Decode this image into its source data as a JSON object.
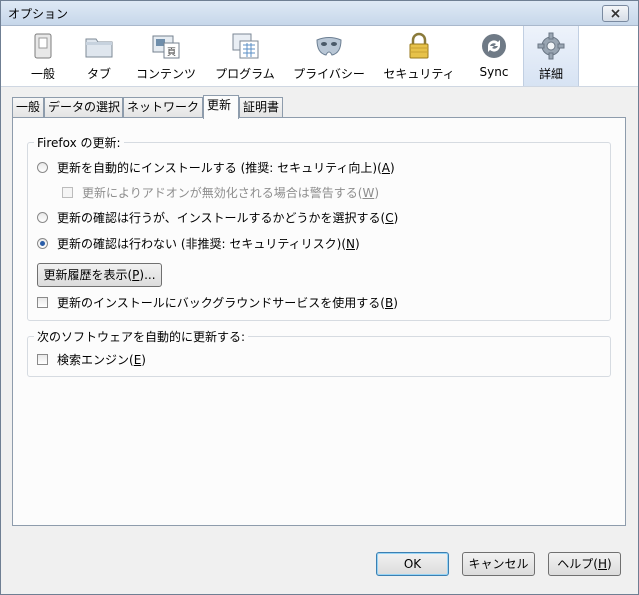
{
  "window": {
    "title": "オプション"
  },
  "toolbar": {
    "items": [
      {
        "label": "一般",
        "icon": "general-switch-icon"
      },
      {
        "label": "タブ",
        "icon": "tabs-folder-icon"
      },
      {
        "label": "コンテンツ",
        "icon": "content-page-icon"
      },
      {
        "label": "プログラム",
        "icon": "applications-calendar-icon"
      },
      {
        "label": "プライバシー",
        "icon": "privacy-mask-icon"
      },
      {
        "label": "セキュリティ",
        "icon": "security-lock-icon"
      },
      {
        "label": "Sync",
        "icon": "sync-arrows-icon"
      },
      {
        "label": "詳細",
        "icon": "advanced-gear-icon"
      }
    ],
    "selected": "詳細"
  },
  "tabs": {
    "items": [
      "一般",
      "データの選択",
      "ネットワーク",
      "更新",
      "証明書"
    ],
    "selected": "更新"
  },
  "firefox_updates": {
    "title": "Firefox の更新:",
    "option_auto": {
      "label": "更新を自動的にインストールする (推奨: セキュリティ向上)(",
      "key": "A",
      "tail": ")"
    },
    "option_warn_addons": {
      "label": "更新によりアドオンが無効化される場合は警告する(",
      "key": "W",
      "tail": ")"
    },
    "option_ask": {
      "label": "更新の確認は行うが、インストールするかどうかを選択する(",
      "key": "C",
      "tail": ")"
    },
    "option_never": {
      "label": "更新の確認は行わない (非推奨: セキュリティリスク)(",
      "key": "N",
      "tail": ")"
    },
    "history_button": {
      "label": "更新履歴を表示(",
      "key": "P",
      "tail": ")..."
    },
    "background_service": {
      "label": "更新のインストールにバックグラウンドサービスを使用する(",
      "key": "B",
      "tail": ")"
    },
    "selected_option": "never"
  },
  "other_updates": {
    "title": "次のソフトウェアを自動的に更新する:",
    "search_engines": {
      "label": "検索エンジン(",
      "key": "E",
      "tail": ")"
    }
  },
  "footer": {
    "ok": "OK",
    "cancel": "キャンセル",
    "help": {
      "label": "ヘルプ(",
      "key": "H",
      "tail": ")"
    }
  }
}
